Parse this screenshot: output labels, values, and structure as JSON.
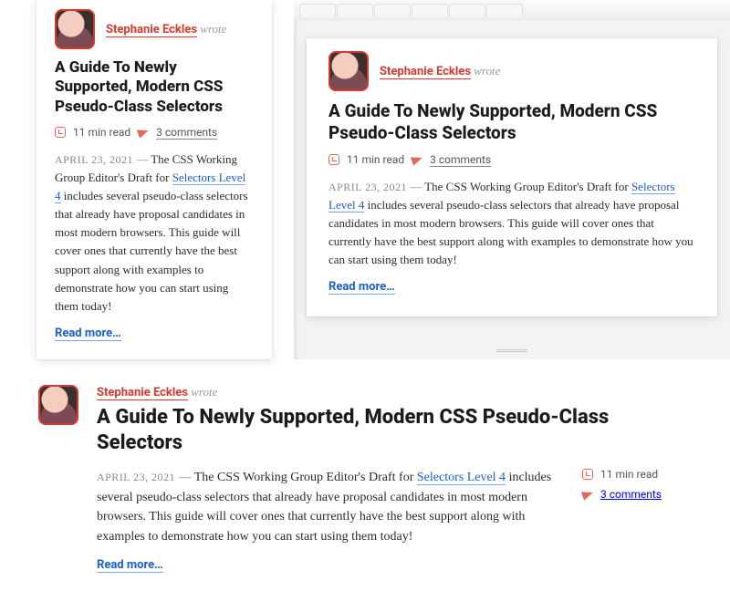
{
  "author": {
    "name": "Stephanie Eckles",
    "wrote": "wrote"
  },
  "article": {
    "title": "A Guide To Newly Supported, Modern CSS Pseudo-Class Selectors",
    "date": "APRIL 23, 2021",
    "reading_time": "11 min read",
    "comments": "3 comments",
    "excerpt_pre": "The CSS Working Group Editor's Draft for ",
    "link_text": "Selectors Level 4",
    "excerpt_post": " includes several pseudo-class selectors that already have proposal candidates in most modern browsers. This guide will cover ones that currently have the best support along with examples to demonstrate how you can start using them today!",
    "read_more": "Read more…"
  },
  "colors": {
    "accent": "#d33a2c",
    "link": "#1a5fd0"
  }
}
